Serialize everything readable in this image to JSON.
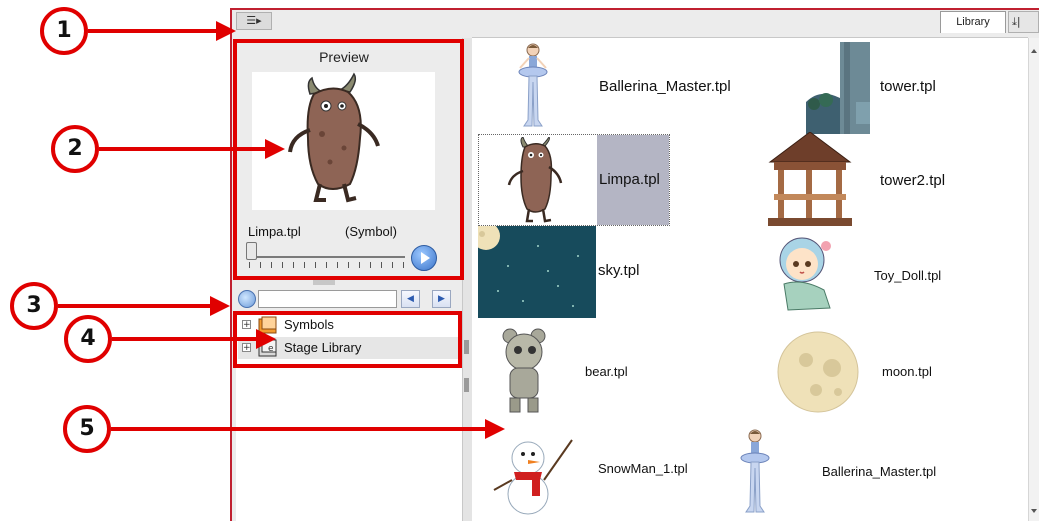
{
  "window": {
    "tab_label": "Library",
    "menu_button": "☰▸",
    "tab_icons": "⤓|"
  },
  "preview": {
    "title": "Preview",
    "selected_name": "Limpa.tpl",
    "selected_type": "(Symbol)",
    "slider_fraction": 0.0
  },
  "search": {
    "value": "",
    "prev_label": "◀",
    "next_label": "▶"
  },
  "tree": {
    "items": [
      {
        "label": "Symbols",
        "expander": "+"
      },
      {
        "label": "Stage Library",
        "expander": "+"
      }
    ]
  },
  "library": {
    "items": [
      {
        "label": "Ballerina_Master.tpl",
        "icon": "ballerina-thumbnail"
      },
      {
        "label": "tower.tpl",
        "icon": "tower-thumbnail"
      },
      {
        "label": "Limpa.tpl",
        "icon": "limpa-thumbnail",
        "selected": true
      },
      {
        "label": "tower2.tpl",
        "icon": "gazebo-thumbnail"
      },
      {
        "label": "sky.tpl",
        "icon": "sky-thumbnail"
      },
      {
        "label": "Toy_Doll.tpl",
        "icon": "doll-thumbnail"
      },
      {
        "label": "bear.tpl",
        "icon": "bear-thumbnail"
      },
      {
        "label": "moon.tpl",
        "icon": "moon-thumbnail"
      },
      {
        "label": "SnowMan_1.tpl",
        "icon": "snowman-thumbnail"
      },
      {
        "label": "Ballerina_Master.tpl",
        "icon": "ballerina-thumbnail"
      }
    ]
  },
  "annotations": {
    "callouts": [
      "1",
      "2",
      "3",
      "4",
      "5"
    ]
  },
  "colors": {
    "annotation_red": "#e00000",
    "selection_gray": "#b4b5c4",
    "sky_blue": "#174b5c"
  }
}
